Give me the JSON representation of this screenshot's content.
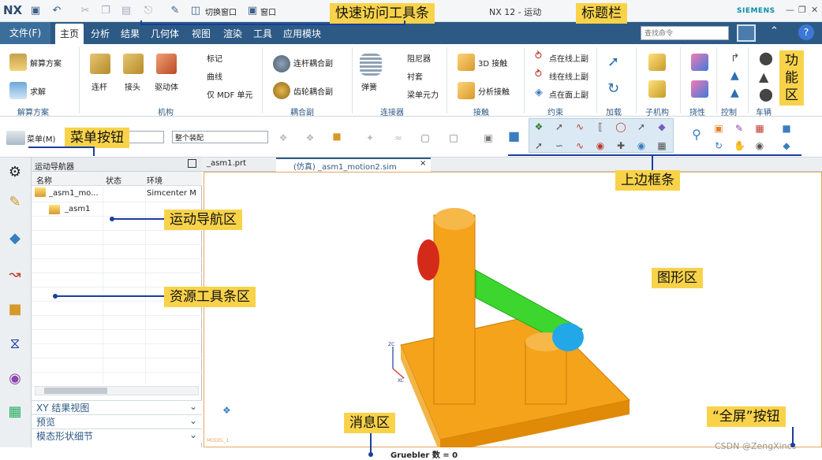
{
  "app": {
    "logo": "NX",
    "title": "NX 12 - 运动",
    "brand": "SIEMENS",
    "search_placeholder": "查找命令"
  },
  "quick_access": {
    "switch_window": "切换窗口",
    "window": "窗口"
  },
  "ribbon": {
    "file_tab": "文件(F)",
    "tabs": [
      "主页",
      "分析",
      "结果",
      "几何体",
      "视图",
      "渲染",
      "工具",
      "应用模块"
    ],
    "groups": {
      "solution": {
        "label": "解算方案",
        "buttons": [
          "解算方案",
          "求解"
        ]
      },
      "mechanism": {
        "label": "机构",
        "buttons": [
          "连杆",
          "接头",
          "驱动体"
        ],
        "small": [
          "标记",
          "曲线",
          "仅 MDF 单元"
        ]
      },
      "coupler": {
        "label": "耦合副",
        "buttons": [
          "连杆耦合副",
          "齿轮耦合副"
        ]
      },
      "connector": {
        "label": "连接器",
        "buttons": [
          "弹簧",
          "阻尼器",
          "衬套",
          "梁单元力"
        ]
      },
      "contact": {
        "label": "接触",
        "buttons": [
          "3D 接触",
          "分析接触"
        ]
      },
      "constraint": {
        "label": "约束",
        "buttons": [
          "点在线上副",
          "线在线上副",
          "点在面上副"
        ]
      },
      "load": {
        "label": "加载"
      },
      "submechanism": {
        "label": "子机构"
      },
      "flexibility": {
        "label": "挠性"
      },
      "control": {
        "label": "控制"
      },
      "vehicle": {
        "label": "车辆"
      }
    }
  },
  "toolbar": {
    "menu_button": "菜单(M)",
    "scope_select": "整个装配"
  },
  "navigator": {
    "title": "运动导航器",
    "columns": [
      "名称",
      "状态",
      "环境"
    ],
    "rows": [
      {
        "name": "_asm1_mo...",
        "status": "",
        "env": "Simcenter M"
      },
      {
        "name": "_asm1",
        "status": "",
        "env": ""
      }
    ],
    "panels": [
      "XY 结果视图",
      "预览",
      "模态形状细节"
    ]
  },
  "graphics_tabs": [
    {
      "label": "_asm1.prt",
      "active": false
    },
    {
      "label": "(仿真) _asm1_motion2.sim",
      "active": true
    }
  ],
  "close_glyph": "×",
  "axes": {
    "z": "ZC",
    "x": "XC",
    "model": "MODEL_1"
  },
  "status": {
    "message": "Gruebler 数 = 0"
  },
  "watermark": "CSDN @ZengXincs",
  "annotations": {
    "quick_access": "快速访问工具条",
    "title_bar": "标题栏",
    "function_area": "功\n能\n区",
    "menu_button": "菜单按钮",
    "border_bar": "上边框条",
    "motion_nav": "运动导航区",
    "resource_bar": "资源工具条区",
    "graphics": "图形区",
    "message": "消息区",
    "fullscreen": "“全屏”按钮"
  },
  "colors": {
    "ribbon_blue": "#2d5a85",
    "annotation_yellow": "#f8d34a",
    "arrow_blue": "#1a3ea0",
    "part_orange": "#f5a31a",
    "link_green": "#3dd62e",
    "pin_red": "#d42a1a",
    "pin_cyan": "#22a8e8"
  }
}
